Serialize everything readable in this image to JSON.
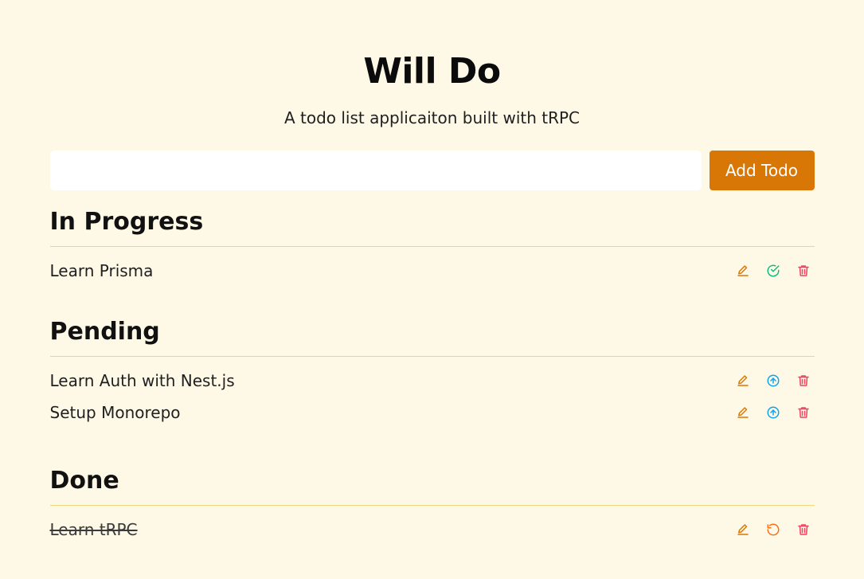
{
  "header": {
    "title": "Will Do",
    "subtitle": "A todo list applicaiton built with tRPC"
  },
  "add_todo": {
    "input_value": "",
    "button_label": "Add Todo"
  },
  "colors": {
    "background": "#fef9e6",
    "accent": "#d97706",
    "edit_icon": "#d97706",
    "complete_icon": "#10b981",
    "promote_icon": "#0ea5e9",
    "restore_icon": "#f97316",
    "delete_icon": "#f43f5e",
    "divider": "#f2d37e"
  },
  "sections": {
    "in_progress": {
      "title": "In Progress",
      "items": [
        {
          "label": "Learn Prisma",
          "icons": [
            "pencil-icon",
            "check-circle-icon",
            "trash-icon"
          ]
        }
      ]
    },
    "pending": {
      "title": "Pending",
      "items": [
        {
          "label": "Learn Auth with Nest.js",
          "icons": [
            "pencil-icon",
            "arrow-up-circle-icon",
            "trash-icon"
          ]
        },
        {
          "label": "Setup Monorepo",
          "icons": [
            "pencil-icon",
            "arrow-up-circle-icon",
            "trash-icon"
          ]
        }
      ]
    },
    "done": {
      "title": "Done",
      "items": [
        {
          "label": "Learn tRPC",
          "icons": [
            "pencil-icon",
            "restore-icon",
            "trash-icon"
          ]
        }
      ]
    }
  }
}
